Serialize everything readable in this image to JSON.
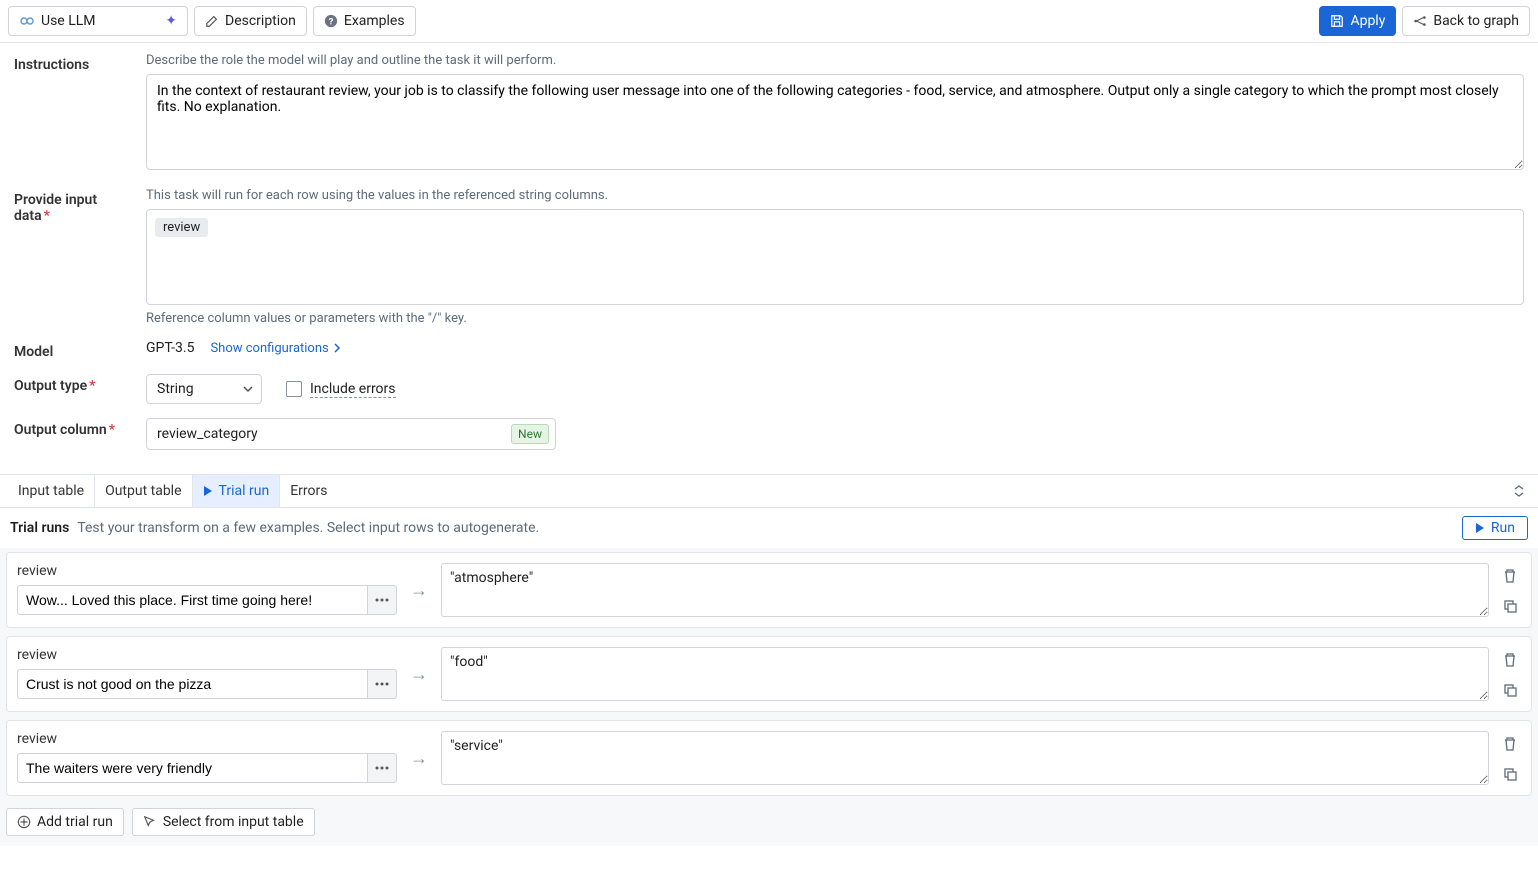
{
  "toolbar": {
    "title": "Use LLM",
    "description_btn": "Description",
    "examples_btn": "Examples",
    "apply_btn": "Apply",
    "back_btn": "Back to graph"
  },
  "form": {
    "instructions_label": "Instructions",
    "instructions_helper": "Describe the role the model will play and outline the task it will perform.",
    "instructions_value": "In the context of restaurant review, your job is to classify the following user message into one of the following categories - food, service, and atmosphere. Output only a single category to which the prompt most closely fits. No explanation.",
    "input_label": "Provide input data",
    "input_helper": "This task will run for each row using the values in the referenced string columns.",
    "input_token": "review",
    "input_footer": "Reference column values or parameters with the \"/\" key.",
    "model_label": "Model",
    "model_value": "GPT-3.5",
    "show_config": "Show configurations",
    "output_type_label": "Output type",
    "output_type_value": "String",
    "include_errors": "Include errors",
    "output_column_label": "Output column",
    "output_column_value": "review_category",
    "new_badge": "New"
  },
  "tabs": {
    "input": "Input table",
    "output": "Output table",
    "trial": "Trial run",
    "errors": "Errors"
  },
  "trial": {
    "head_bold": "Trial runs",
    "head_text": "Test your transform on a few examples. Select input rows to autogenerate.",
    "run_btn": "Run",
    "rows": [
      {
        "label": "review",
        "input": "Wow... Loved this place. First time going here!",
        "output": "\"atmosphere\""
      },
      {
        "label": "review",
        "input": "Crust is not good on the pizza",
        "output": "\"food\""
      },
      {
        "label": "review",
        "input": "The waiters were very friendly",
        "output": "\"service\""
      }
    ],
    "add_btn": "Add trial run",
    "select_btn": "Select from input table"
  }
}
